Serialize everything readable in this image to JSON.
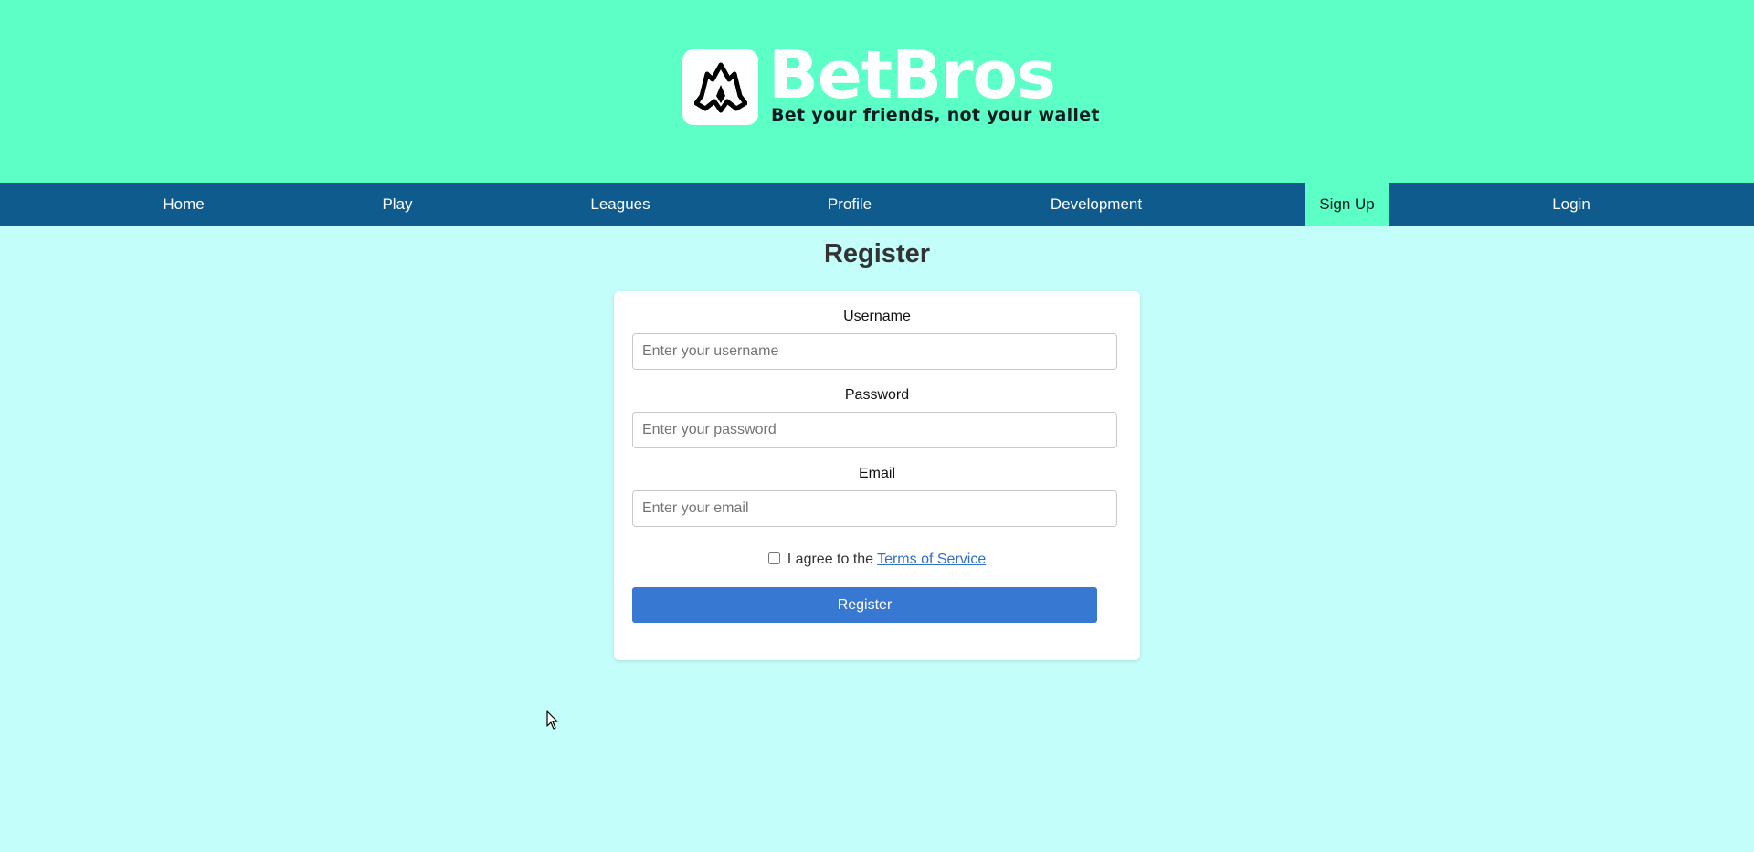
{
  "brand": {
    "name": "BetBros",
    "tagline": "Bet your friends, not your wallet",
    "logo_icon": "flame-crown-logo-icon"
  },
  "nav": {
    "items": [
      {
        "label": "Home"
      },
      {
        "label": "Play"
      },
      {
        "label": "Leagues"
      },
      {
        "label": "Profile"
      },
      {
        "label": "Development"
      },
      {
        "label": "Sign Up",
        "active": true
      },
      {
        "label": "Login"
      }
    ]
  },
  "page": {
    "title": "Register"
  },
  "form": {
    "username": {
      "label": "Username",
      "value": "",
      "placeholder": "Enter your username"
    },
    "password": {
      "label": "Password",
      "value": "",
      "placeholder": "Enter your password"
    },
    "email": {
      "label": "Email",
      "value": "",
      "placeholder": "Enter your email"
    },
    "agree_text": "I agree to the",
    "tos_link": "Terms of Service",
    "agree_checked": false,
    "submit_label": "Register"
  },
  "colors": {
    "header_bg": "#5cffc6",
    "nav_bg": "#0f5b8e",
    "page_bg": "#c3fefa",
    "button_bg": "#3778d3",
    "link": "#2f6fcf"
  }
}
